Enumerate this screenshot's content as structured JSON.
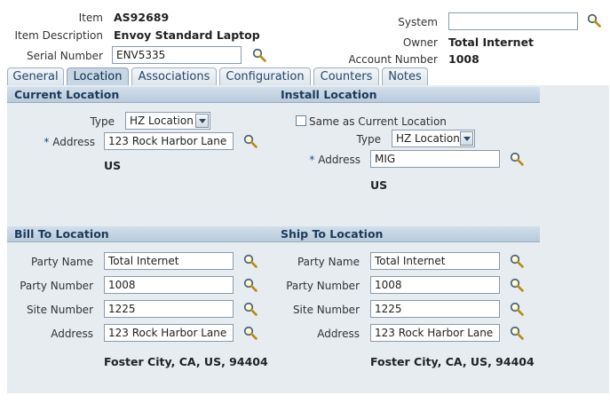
{
  "header": {
    "item_label": "Item",
    "item_value": "AS92689",
    "item_desc_label": "Item Description",
    "item_desc_value": "Envoy Standard Laptop",
    "serial_label": "Serial Number",
    "serial_value": "ENV5335",
    "system_label": "System",
    "system_value": "",
    "owner_label": "Owner",
    "owner_value": "Total Internet",
    "account_label": "Account Number",
    "account_value": "1008"
  },
  "tabs": [
    {
      "label": "General"
    },
    {
      "label": "Location"
    },
    {
      "label": "Associations"
    },
    {
      "label": "Configuration"
    },
    {
      "label": "Counters"
    },
    {
      "label": "Notes"
    }
  ],
  "current_location": {
    "title": "Current Location",
    "type_label": "Type",
    "type_value": "HZ Location",
    "address_label": "Address",
    "address_value": "123 Rock Harbor Lane",
    "country": "US"
  },
  "install_location": {
    "title": "Install Location",
    "same_label": "Same as Current Location",
    "type_label": "Type",
    "type_value": "HZ Location",
    "address_label": "Address",
    "address_value": "MIG",
    "country": "US"
  },
  "bill_to": {
    "title": "Bill To Location",
    "party_name_label": "Party Name",
    "party_name_value": "Total Internet",
    "party_number_label": "Party Number",
    "party_number_value": "1008",
    "site_number_label": "Site Number",
    "site_number_value": "1225",
    "address_label": "Address",
    "address_value": "123 Rock Harbor Lane",
    "city_line": "Foster City, CA, US, 94404"
  },
  "ship_to": {
    "title": "Ship To Location",
    "party_name_label": "Party Name",
    "party_name_value": "Total Internet",
    "party_number_label": "Party Number",
    "party_number_value": "1008",
    "site_number_label": "Site Number",
    "site_number_value": "1225",
    "address_label": "Address",
    "address_value": "123 Rock Harbor Lane",
    "city_line": "Foster City, CA, US, 94404"
  },
  "required_marker": "*",
  "icons": {
    "lookup": "magnifier-icon"
  }
}
